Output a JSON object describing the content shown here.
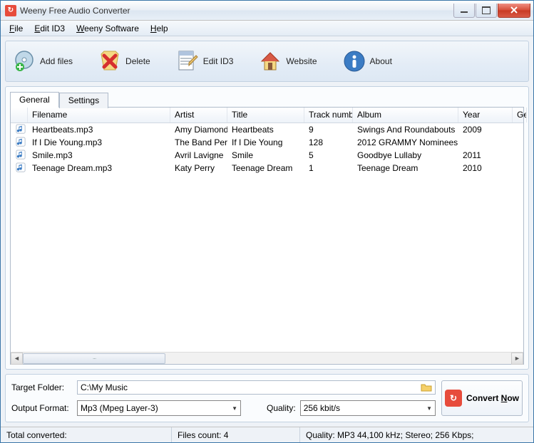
{
  "window": {
    "title": "Weeny Free Audio Converter"
  },
  "menu": {
    "file": "File",
    "edit_id3": "Edit ID3",
    "weeny_software": "Weeny Software",
    "help": "Help"
  },
  "toolbar": {
    "add_files": "Add files",
    "delete": "Delete",
    "edit_id3": "Edit ID3",
    "website": "Website",
    "about": "About"
  },
  "tabs": {
    "general": "General",
    "settings": "Settings"
  },
  "columns": {
    "filename": "Filename",
    "artist": "Artist",
    "title": "Title",
    "track_number": "Track number",
    "album": "Album",
    "year": "Year",
    "genre": "Ge"
  },
  "files": [
    {
      "filename": "Heartbeats.mp3",
      "artist": "Amy Diamond",
      "title": "Heartbeats",
      "track": "9",
      "album": "Swings And Roundabouts",
      "year": "2009"
    },
    {
      "filename": "If I Die Young.mp3",
      "artist": "The Band Perry",
      "title": "If I Die Young",
      "track": "128",
      "album": "2012 GRAMMY Nominees",
      "year": ""
    },
    {
      "filename": "Smile.mp3",
      "artist": "Avril Lavigne",
      "title": "Smile",
      "track": "5",
      "album": "Goodbye Lullaby",
      "year": "2011"
    },
    {
      "filename": "Teenage Dream.mp3",
      "artist": "Katy Perry",
      "title": "Teenage Dream",
      "track": "1",
      "album": "Teenage Dream",
      "year": "2010"
    }
  ],
  "output": {
    "target_folder_label": "Target Folder:",
    "target_folder": "C:\\My Music",
    "format_label": "Output Format:",
    "format": "Mp3 (Mpeg Layer-3)",
    "quality_label": "Quality:",
    "quality": "256 kbit/s",
    "convert_label": "Convert Now"
  },
  "status": {
    "total_converted": "Total converted:",
    "files_count": "Files count: 4",
    "quality": "Quality: MP3 44,100 kHz; Stereo;  256 Kbps;"
  }
}
